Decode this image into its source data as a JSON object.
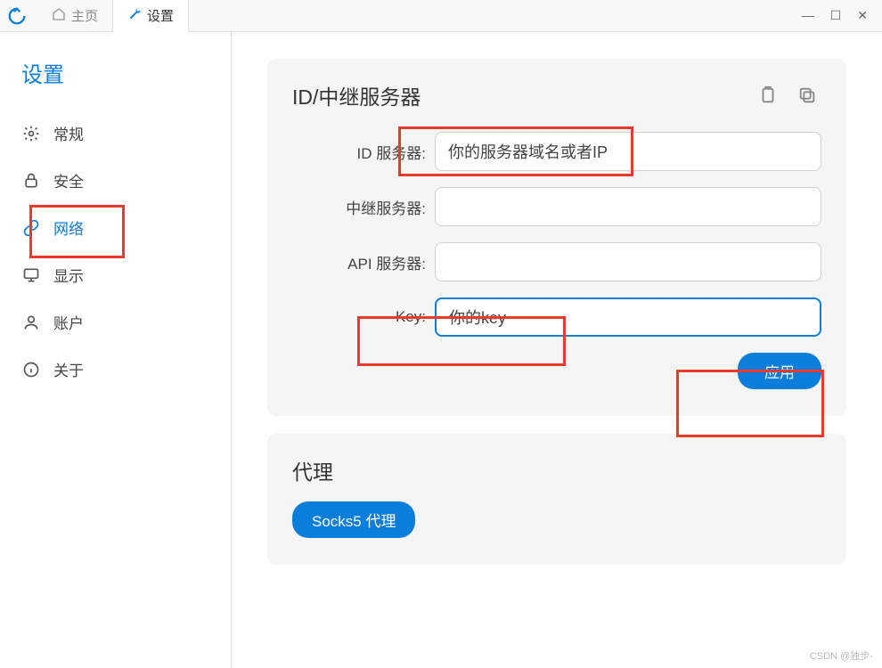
{
  "titlebar": {
    "tab_home": "主页",
    "tab_settings": "设置"
  },
  "sidebar": {
    "title": "设置",
    "items": [
      {
        "label": "常规"
      },
      {
        "label": "安全"
      },
      {
        "label": "网络"
      },
      {
        "label": "显示"
      },
      {
        "label": "账户"
      },
      {
        "label": "关于"
      }
    ]
  },
  "panel_server": {
    "title": "ID/中继服务器",
    "fields": {
      "id_server_label": "ID 服务器:",
      "id_server_value": "你的服务器域名或者IP",
      "relay_label": "中继服务器:",
      "relay_value": "",
      "api_label": "API 服务器:",
      "api_value": "",
      "key_label": "Key:",
      "key_value": "你的key"
    },
    "apply_label": "应用"
  },
  "panel_proxy": {
    "title": "代理",
    "socks5_label": "Socks5 代理"
  },
  "watermark": "CSDN @独步-"
}
